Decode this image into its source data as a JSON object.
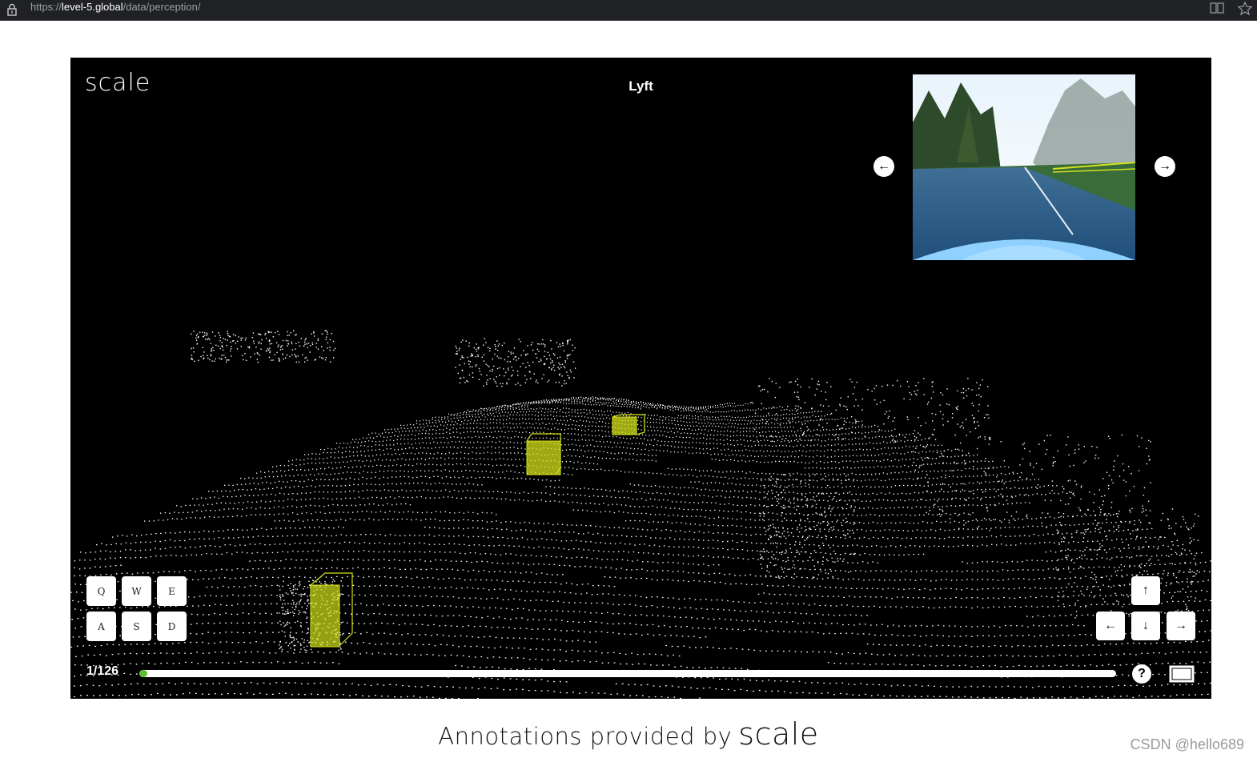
{
  "browser": {
    "url_scheme": "https://",
    "url_host": "level-5.global",
    "url_path": "/data/perception/"
  },
  "viewer": {
    "logo_text": "scale",
    "title": "Lyft",
    "keys_row1": [
      "Q",
      "W",
      "E"
    ],
    "keys_row2": [
      "A",
      "S",
      "D"
    ],
    "arrow_up": "↑",
    "arrow_left": "←",
    "arrow_down": "↓",
    "arrow_right": "→",
    "frame_counter": "1/126",
    "progress_fraction": 0.008,
    "help_label": "?",
    "prev_camera": "←",
    "next_camera": "→",
    "accent_color": "#5fbf2f",
    "annotation_color": "#d4e21a"
  },
  "footer": {
    "text": "Annotations provided by",
    "brand": "scale"
  },
  "watermark": "CSDN @hello689"
}
